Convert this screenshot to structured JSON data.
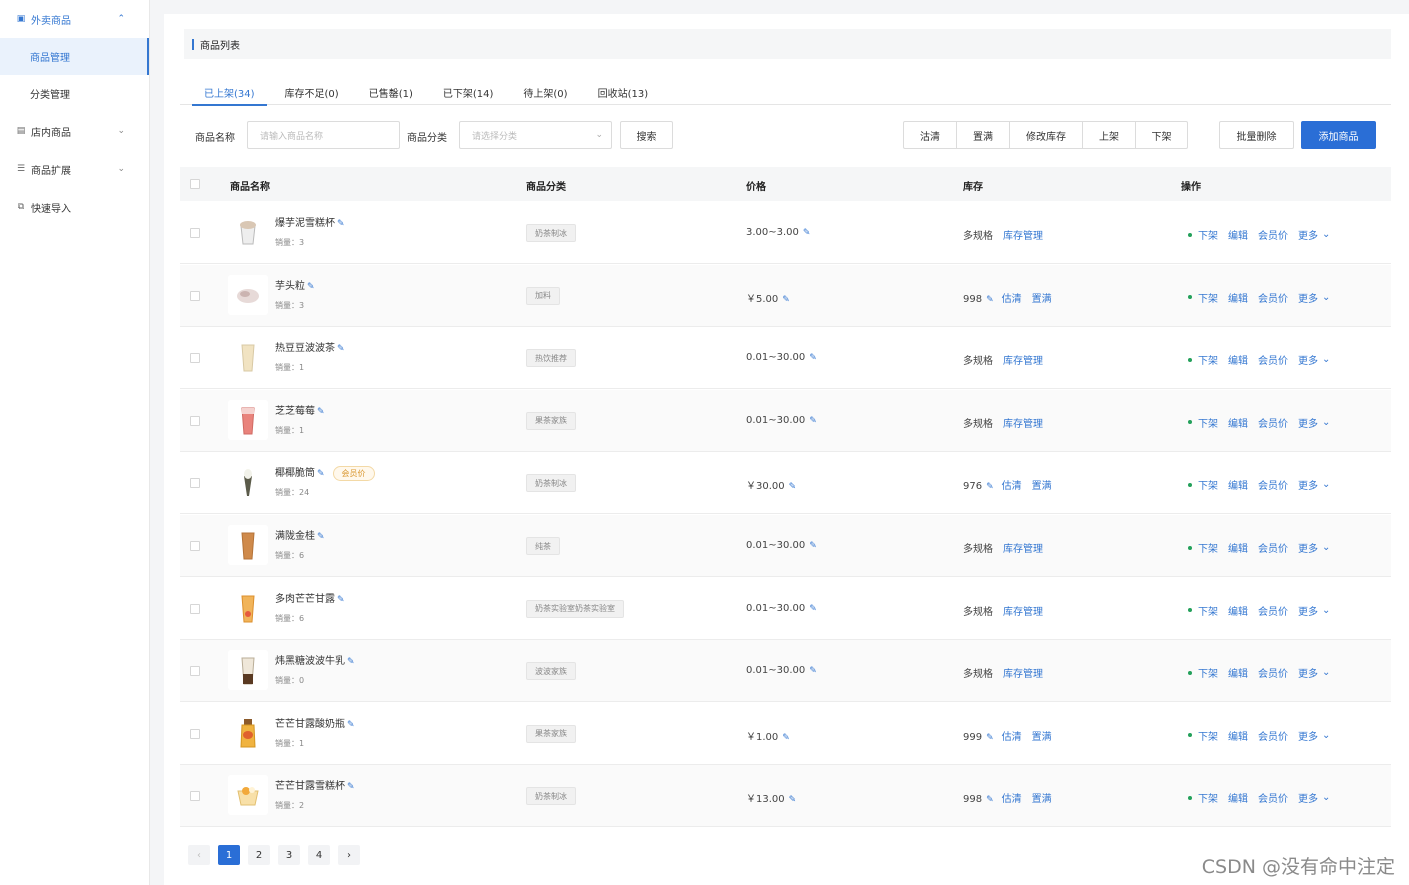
{
  "sidebar": {
    "groups": [
      {
        "label": "外卖商品",
        "open": true,
        "subs": [
          "商品管理",
          "分类管理"
        ]
      },
      {
        "label": "店内商品",
        "open": false
      },
      {
        "label": "商品扩展",
        "open": false
      },
      {
        "label": "快速导入",
        "open": false
      }
    ]
  },
  "header": {
    "title": "商品列表"
  },
  "tabs": [
    "已上架(34)",
    "库存不足(0)",
    "已售罄(1)",
    "已下架(14)",
    "待上架(0)",
    "回收站(13)"
  ],
  "filter": {
    "name_label": "商品名称",
    "name_placeholder": "请输入商品名称",
    "cat_label": "商品分类",
    "cat_placeholder": "请选择分类",
    "search_btn": "搜索",
    "group_btns": [
      "沽清",
      "置满",
      "修改库存",
      "上架",
      "下架"
    ],
    "batch_delete": "批量删除",
    "add_product": "添加商品"
  },
  "table": {
    "headers": [
      "商品名称",
      "商品分类",
      "价格",
      "库存",
      "操作"
    ],
    "sales_prefix": "销量：",
    "member_tag": "会员价",
    "actions": {
      "off": "下架",
      "edit": "编辑",
      "member": "会员价",
      "more": "更多"
    },
    "stock_links": {
      "manage": "库存管理",
      "clear": "估清",
      "fill": "置满"
    },
    "rows": [
      {
        "name": "爆芋泥雪糕杯",
        "sales": "3",
        "category": "奶茶制冰",
        "price": "3.00~3.00",
        "stock": "多规格",
        "multi": true,
        "member": false,
        "thumb": "cup-white"
      },
      {
        "name": "芋头粒",
        "sales": "3",
        "category": "加料",
        "price": "￥5.00",
        "stock": "998",
        "multi": false,
        "member": false,
        "thumb": "taro"
      },
      {
        "name": "热豆豆波波茶",
        "sales": "1",
        "category": "热饮推荐",
        "price": "0.01~30.00",
        "stock": "多规格",
        "multi": true,
        "member": false,
        "thumb": "cup-cream"
      },
      {
        "name": "芝芝莓莓",
        "sales": "1",
        "category": "果茶家族",
        "price": "0.01~30.00",
        "stock": "多规格",
        "multi": true,
        "member": false,
        "thumb": "cup-red"
      },
      {
        "name": "椰椰脆筒",
        "sales": "24",
        "category": "奶茶制冰",
        "price": "￥30.00",
        "stock": "976",
        "multi": false,
        "member": true,
        "thumb": "cone"
      },
      {
        "name": "满陇金桂",
        "sales": "6",
        "category": "纯茶",
        "price": "0.01~30.00",
        "stock": "多规格",
        "multi": true,
        "member": false,
        "thumb": "cup-amber"
      },
      {
        "name": "多肉芒芒甘露",
        "sales": "6",
        "category": "奶茶实验室奶茶实验室",
        "price": "0.01~30.00",
        "stock": "多规格",
        "multi": true,
        "member": false,
        "thumb": "cup-orange"
      },
      {
        "name": "炜黑糖波波牛乳",
        "sales": "0",
        "category": "波波家族",
        "price": "0.01~30.00",
        "stock": "多规格",
        "multi": true,
        "member": false,
        "thumb": "cup-brown"
      },
      {
        "name": "芒芒甘露酸奶瓶",
        "sales": "1",
        "category": "果茶家族",
        "price": "￥1.00",
        "stock": "999",
        "multi": false,
        "member": false,
        "thumb": "bottle"
      },
      {
        "name": "芒芒甘露雪糕杯",
        "sales": "2",
        "category": "奶茶制冰",
        "price": "￥13.00",
        "stock": "998",
        "multi": false,
        "member": false,
        "thumb": "cup-yellow"
      }
    ]
  },
  "pagination": {
    "pages": [
      "1",
      "2",
      "3",
      "4"
    ],
    "prev": "‹",
    "next": "›",
    "current": "1"
  },
  "watermark": "CSDN @没有命中注定"
}
